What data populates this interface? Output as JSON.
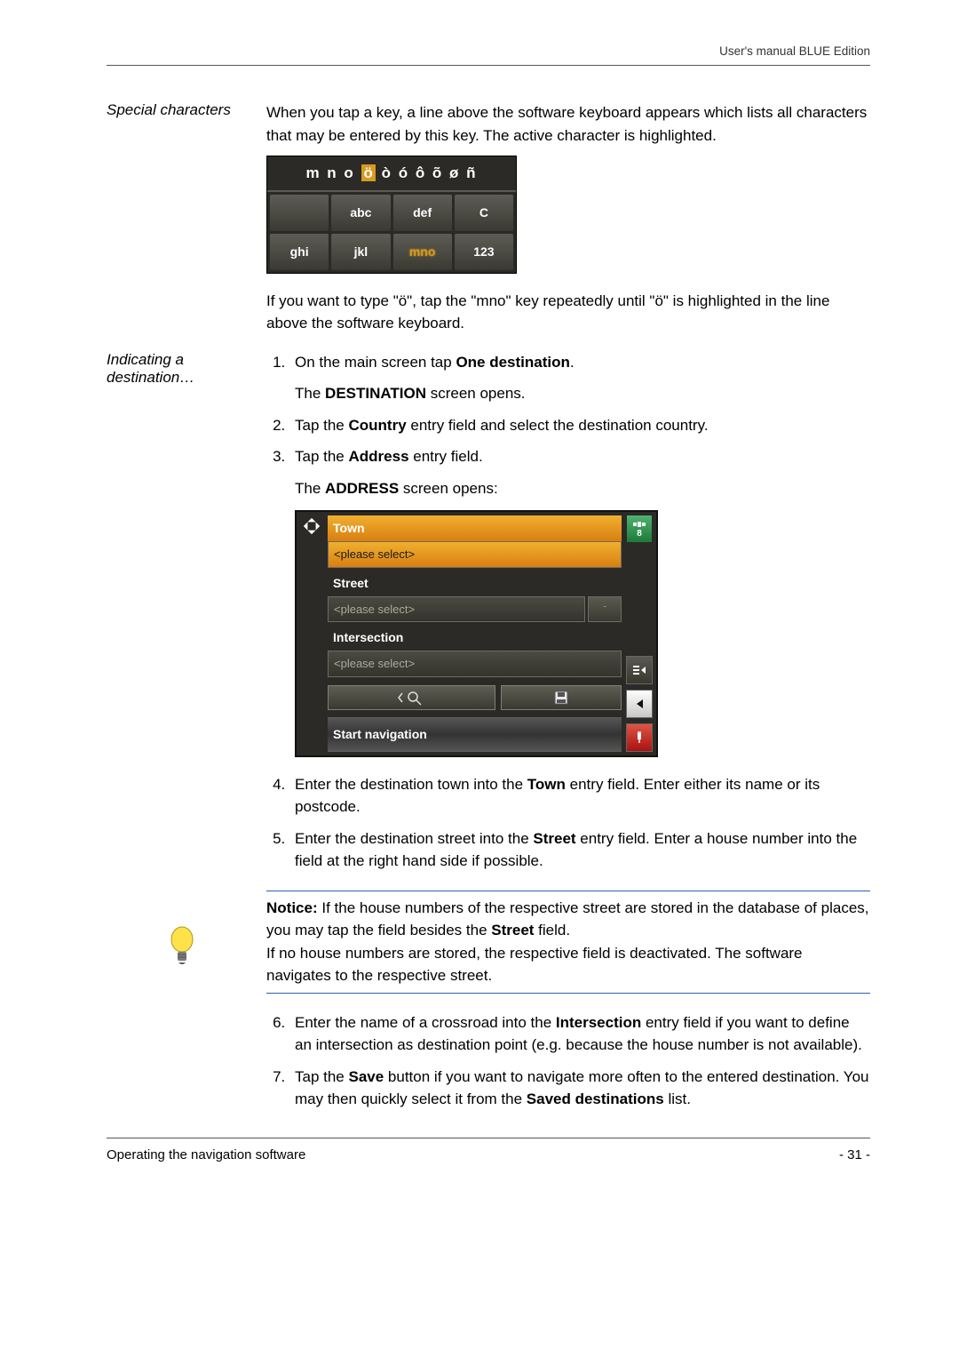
{
  "header": {
    "text": "User's manual BLUE Edition"
  },
  "section1": {
    "side": "Special characters",
    "para1": "When you tap a key, a line above the software keyboard appears which lists all characters that may be entered by this key. The active character is highlighted.",
    "kb_chars_pre": "m n o ",
    "kb_chars_hl": "ö",
    "kb_chars_post": " ò ó ô õ ø ñ",
    "kb_keys": [
      "",
      "abc",
      "def",
      "C",
      "ghi",
      "jkl",
      "mno",
      "123"
    ],
    "para2": "If you want to type \"ö\", tap the \"mno\" key repeatedly until \"ö\" is highlighted in the line above the software keyboard."
  },
  "section2": {
    "side": "Indicating a destination…",
    "step1_pre": "On the main screen tap ",
    "step1_b": "One destination",
    "step1_post": ".",
    "sub1a_pre": "The ",
    "sub1a_sc": "Destination",
    "sub1a_post": " screen opens.",
    "step2_pre": "Tap the ",
    "step2_b": "Country",
    "step2_post": " entry field and select the destination country.",
    "step3_pre": "Tap the ",
    "step3_b": "Address",
    "step3_post": " entry field.",
    "sub3a_pre": "The ",
    "sub3a_sc": "Address",
    "sub3a_post": " screen opens:",
    "screen": {
      "town_label": "Town",
      "town_value": "<please select>",
      "street_label": "Street",
      "street_value": "<please select>",
      "street_num": "-",
      "inter_label": "Intersection",
      "inter_value": "<please select>",
      "start_nav": "Start navigation",
      "sat_count": "8"
    },
    "step4_pre": "Enter the destination town into the ",
    "step4_b": "Town",
    "step4_post": " entry field. Enter either its name or its postcode.",
    "step5_pre": "Enter the destination street into the ",
    "step5_b": "Street",
    "step5_post": " entry field. Enter a house number into the field at the right hand side if possible.",
    "notice": {
      "lead": "Notice:",
      "t1": " If the house numbers of the respective street are stored in the database of places, you may tap the field besides the ",
      "b1": "Street",
      "t2": " field.",
      "t3": "If no house numbers are stored, the respective field is deactivated. The software navigates to the respective street."
    },
    "step6_pre": "Enter the name of a crossroad into the ",
    "step6_b": "Intersection",
    "step6_post": " entry field if you want to define an intersection as destination point (e.g. because the house number is not available).",
    "step7_pre": "Tap the ",
    "step7_b": "Save",
    "step7_mid": " button if you want to navigate more often to the entered destination. You may then quickly select it from the ",
    "step7_b2": "Saved destinations",
    "step7_post": " list."
  },
  "footer": {
    "left": "Operating the navigation software",
    "right": "- 31 -"
  }
}
